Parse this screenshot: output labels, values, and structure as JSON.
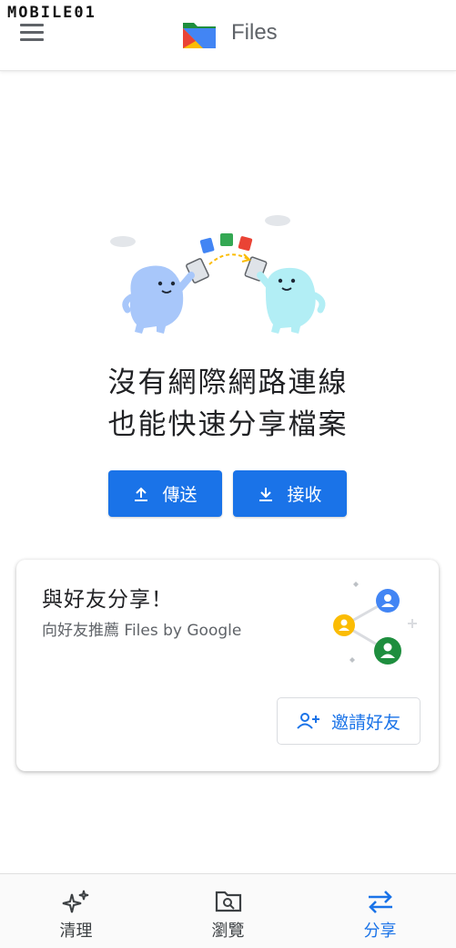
{
  "watermark": "MOBILE01",
  "header": {
    "title": "Files",
    "menu_icon": "menu-icon",
    "logo_icon": "files-logo-icon"
  },
  "empty_state": {
    "line1": "沒有網際網路連線",
    "line2": "也能快速分享檔案"
  },
  "actions": {
    "send_label": "傳送",
    "receive_label": "接收"
  },
  "share_card": {
    "title": "與好友分享！",
    "subtitle": "向好友推薦 Files by Google",
    "invite_label": "邀請好友"
  },
  "bottom_nav": {
    "items": [
      {
        "label": "清理",
        "icon": "sparkle-icon",
        "active": false
      },
      {
        "label": "瀏覽",
        "icon": "folder-search-icon",
        "active": false
      },
      {
        "label": "分享",
        "icon": "swap-arrows-icon",
        "active": true
      }
    ]
  },
  "colors": {
    "accent": "#1a73e8",
    "text": "#202124",
    "secondary_text": "#5f6368"
  }
}
